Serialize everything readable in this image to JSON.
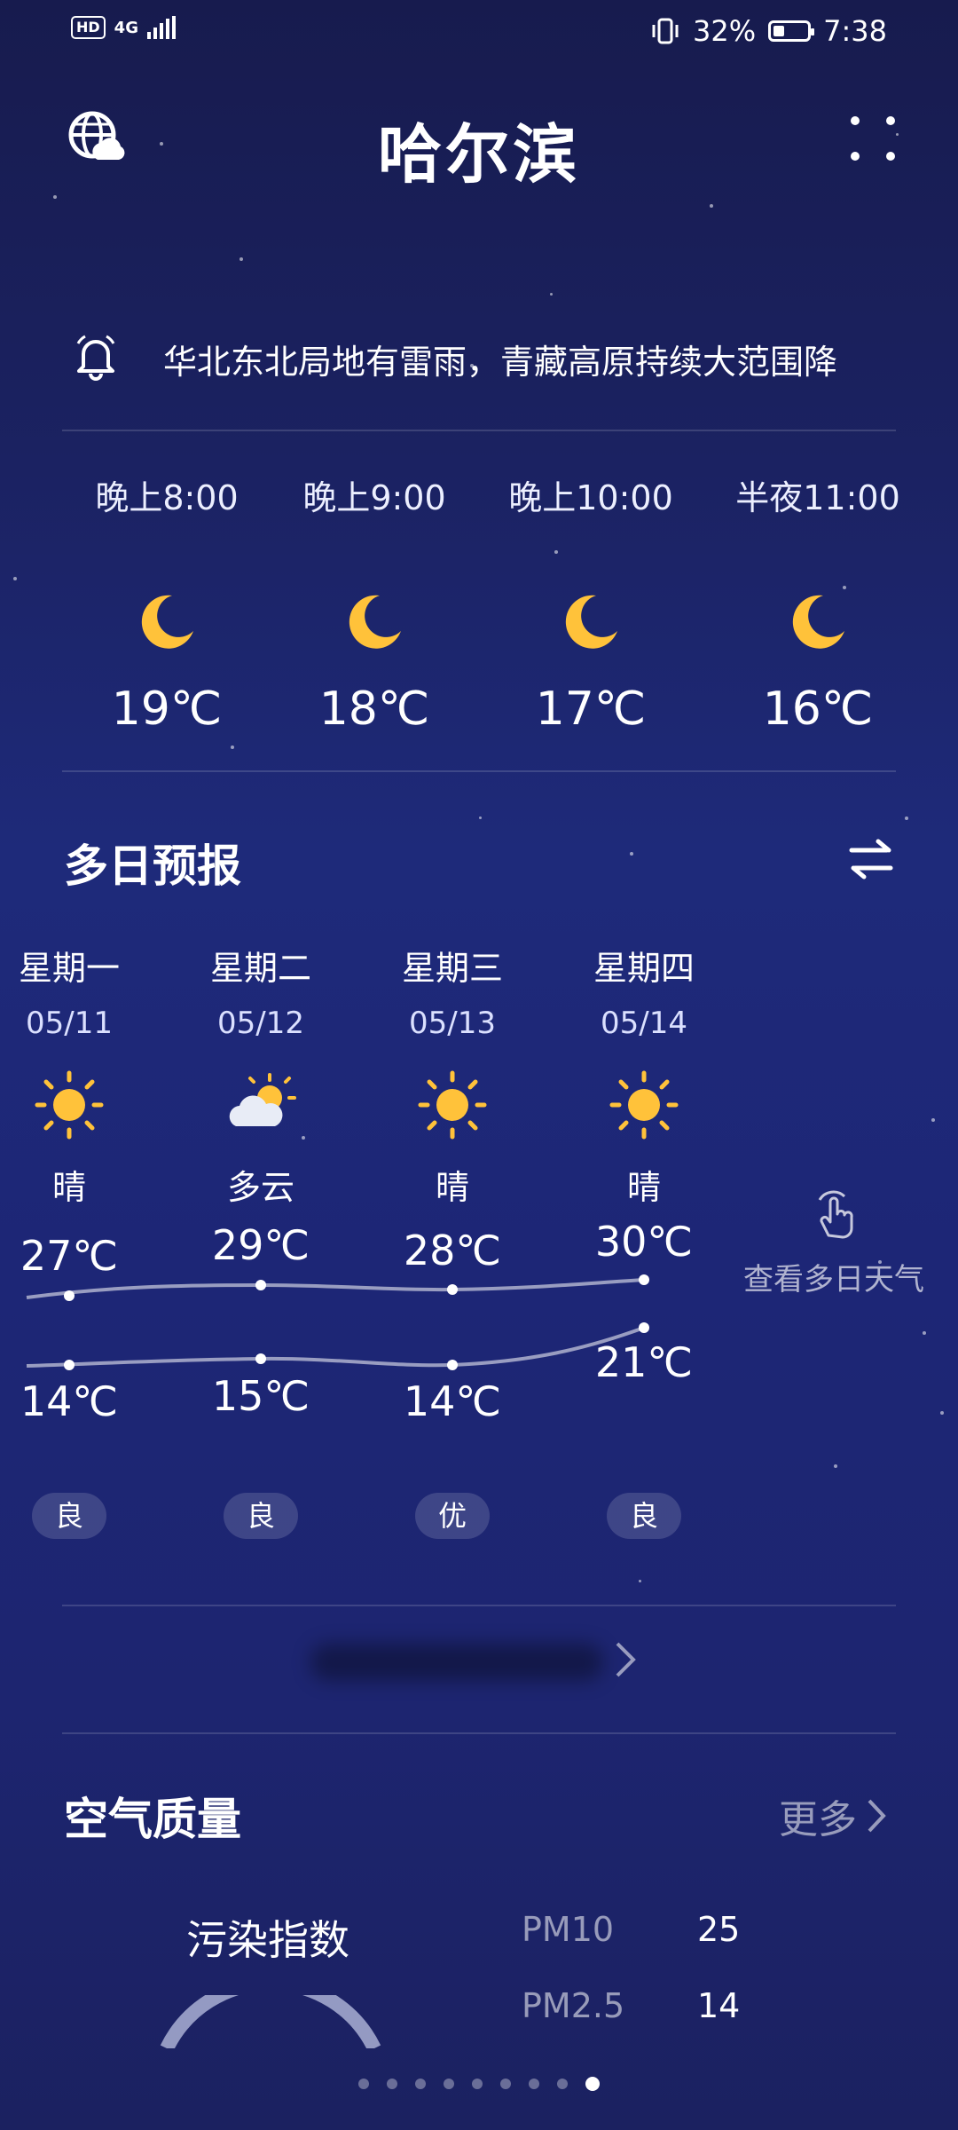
{
  "status_bar": {
    "network_badge": "HD",
    "network_type": "4G",
    "battery_percent": "32%",
    "time": "7:38",
    "battery_level": 0.32
  },
  "header": {
    "city": "哈尔滨"
  },
  "alert": {
    "text": "华北东北局地有雷雨，青藏高原持续大范围降"
  },
  "hourly": [
    {
      "time": "晚上8:00",
      "icon": "moon-icon",
      "temp": "19℃"
    },
    {
      "time": "晚上9:00",
      "icon": "moon-icon",
      "temp": "18℃"
    },
    {
      "time": "晚上10:00",
      "icon": "moon-icon",
      "temp": "17℃"
    },
    {
      "time": "半夜11:00",
      "icon": "moon-icon",
      "temp": "16℃"
    }
  ],
  "multi_day": {
    "title": "多日预报",
    "days": [
      {
        "name": "星期一",
        "date": "05/11",
        "icon": "sun-icon",
        "condition": "晴",
        "high": "27℃",
        "low": "14℃",
        "aqi": "良"
      },
      {
        "name": "星期二",
        "date": "05/12",
        "icon": "partly-cloudy-icon",
        "condition": "多云",
        "high": "29℃",
        "low": "15℃",
        "aqi": "良"
      },
      {
        "name": "星期三",
        "date": "05/13",
        "icon": "sun-icon",
        "condition": "晴",
        "high": "28℃",
        "low": "14℃",
        "aqi": "优"
      },
      {
        "name": "星期四",
        "date": "05/14",
        "icon": "sun-icon",
        "condition": "晴",
        "high": "30℃",
        "low": "21℃",
        "aqi": "良"
      }
    ],
    "view_more": "查看多日天气"
  },
  "air_quality": {
    "title": "空气质量",
    "more": "更多",
    "pollution_label": "污染指数",
    "pm10_label": "PM10",
    "pm10_value": "25",
    "pm25_label": "PM2.5",
    "pm25_value": "14"
  },
  "page_indicator": {
    "count": 9,
    "active_index": 8
  },
  "colors": {
    "background_top": "#171b4e",
    "background_mid": "#1e2a7a",
    "moon": "#ffc23a",
    "sun": "#ffc23a"
  }
}
